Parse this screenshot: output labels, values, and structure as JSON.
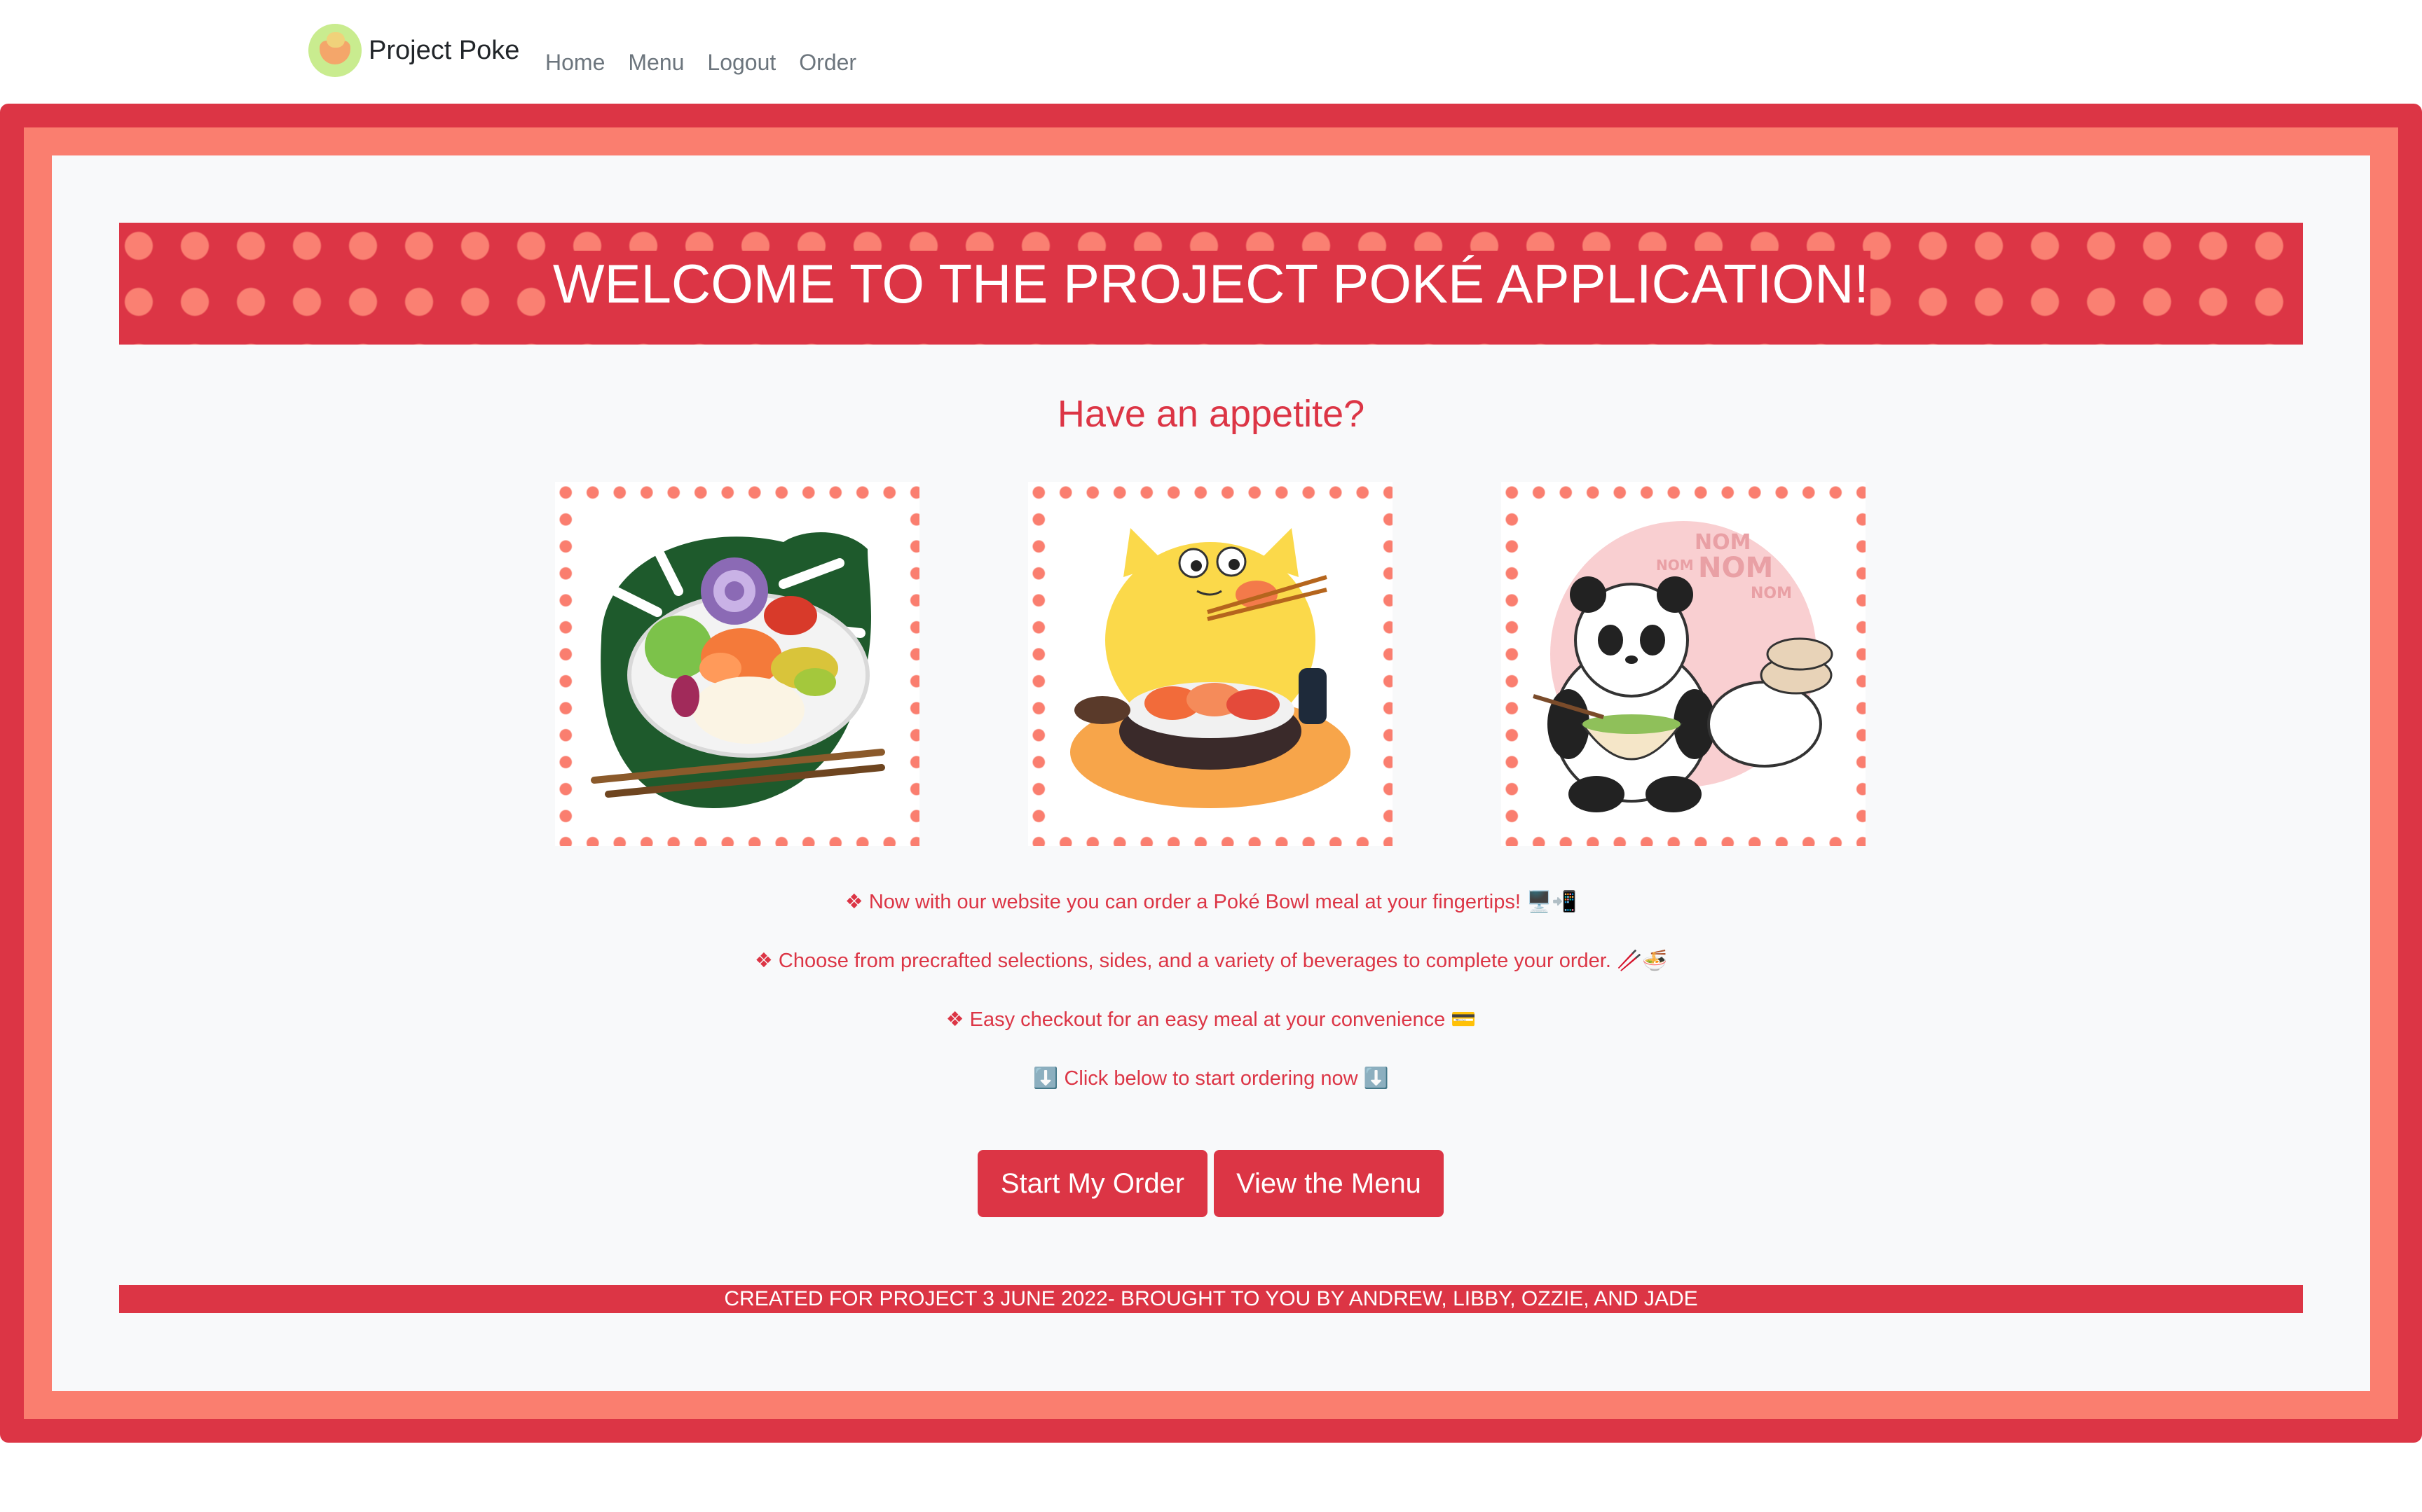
{
  "nav": {
    "brand": "Project Poke",
    "links": [
      "Home",
      "Menu",
      "Logout",
      "Order"
    ]
  },
  "banner": {
    "title": "WELCOME TO THE PROJECT POKÉ APPLICATION!"
  },
  "subtitle": "Have an appetite?",
  "images": [
    {
      "name": "poke-bowl-illustration"
    },
    {
      "name": "cat-eating-poke-illustration",
      "text": ""
    },
    {
      "name": "panda-eating-poke-illustration",
      "text": "NOM NOM NOM NOM"
    }
  ],
  "features": [
    "❖ Now with our website you can order a Poké Bowl meal at your fingertips! 🖥️📲",
    "❖ Choose from precrafted selections, sides, and a variety of beverages to complete your order. 🥢🍜",
    "❖ Easy checkout for an easy meal at your convenience 💳",
    "⬇️ Click below to start ordering now ⬇️"
  ],
  "buttons": {
    "start": "Start My Order",
    "menu": "View the Menu"
  },
  "footer": "CREATED FOR PROJECT 3 JUNE 2022- BROUGHT TO YOU BY ANDREW, LIBBY, OZZIE, AND JADE",
  "colors": {
    "primary": "#dc3545",
    "salmon": "#fa7e6f",
    "background": "#f8f9fa"
  }
}
